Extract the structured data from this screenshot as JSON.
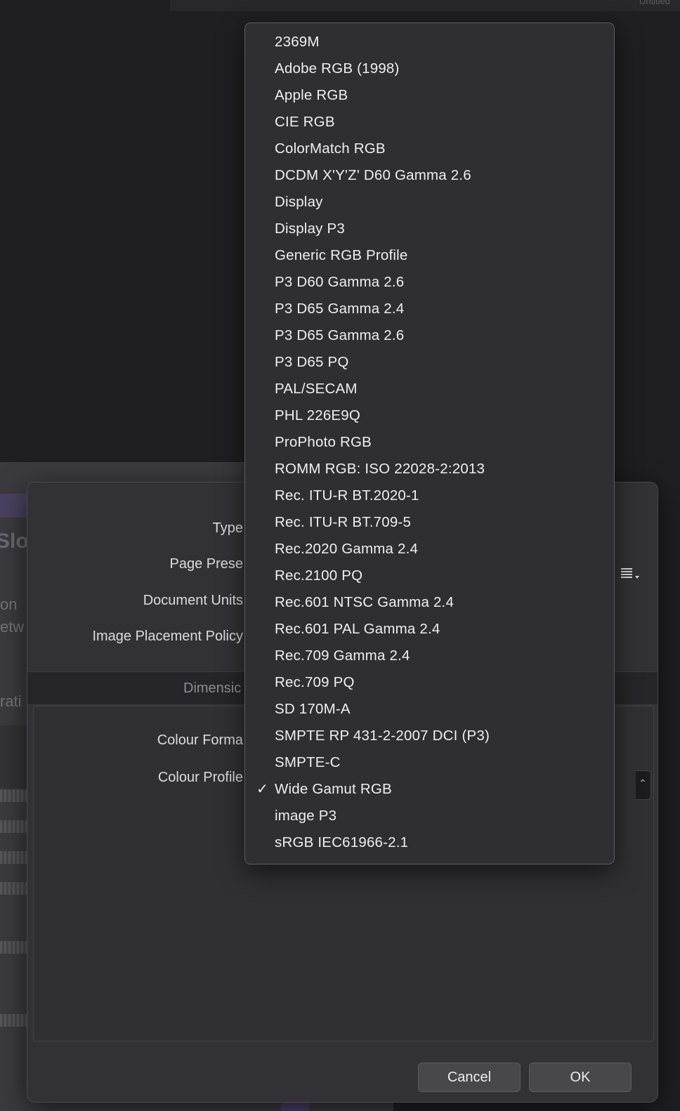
{
  "top_strip": {
    "title": "Untitled"
  },
  "background_window": {
    "heading": "Slot",
    "text_lines": [
      "on",
      "etw",
      "rati"
    ]
  },
  "dialog": {
    "labels": {
      "type": "Type",
      "page_preset": "Page Prese",
      "document_units": "Document Units",
      "image_placement_policy": "Image Placement Policy",
      "colour_format": "Colour Forma",
      "colour_profile": "Colour Profile"
    },
    "section_title": "Dimensic",
    "cancel_label": "Cancel",
    "ok_label": "OK",
    "list_view_icon": "list-view-icon"
  },
  "colour_profile_menu": {
    "selected": "Wide Gamut RGB",
    "check_glyph": "✓",
    "items": [
      "2369M",
      "Adobe RGB (1998)",
      "Apple RGB",
      "CIE RGB",
      "ColorMatch RGB",
      "DCDM X'Y'Z' D60 Gamma 2.6",
      "Display",
      "Display P3",
      "Generic RGB Profile",
      "P3 D60 Gamma 2.6",
      "P3 D65 Gamma 2.4",
      "P3 D65 Gamma 2.6",
      "P3 D65 PQ",
      "PAL/SECAM",
      "PHL 226E9Q",
      "ProPhoto RGB",
      "ROMM RGB: ISO 22028-2:2013",
      "Rec. ITU-R BT.2020-1",
      "Rec. ITU-R BT.709-5",
      "Rec.2020 Gamma 2.4",
      "Rec.2100 PQ",
      "Rec.601 NTSC Gamma 2.4",
      "Rec.601 PAL Gamma 2.4",
      "Rec.709 Gamma 2.4",
      "Rec.709 PQ",
      "SD 170M-A",
      "SMPTE RP 431-2-2007 DCI (P3)",
      "SMPTE-C",
      "Wide Gamut RGB",
      "image P3",
      "sRGB IEC61966-2.1"
    ]
  }
}
